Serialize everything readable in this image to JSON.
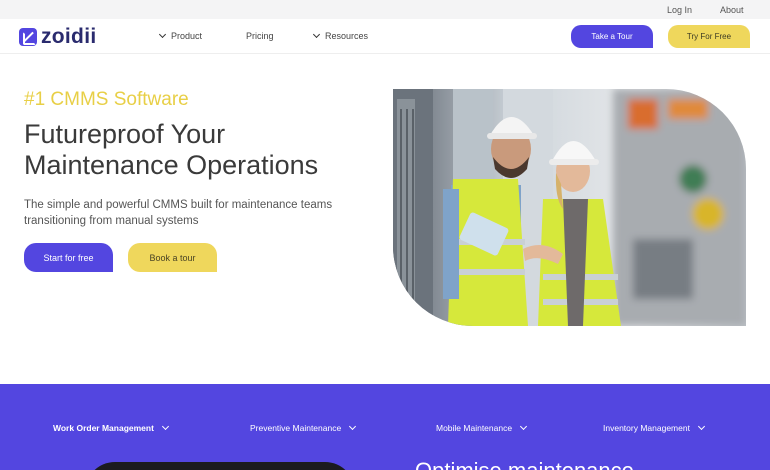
{
  "utility": {
    "login": "Log In",
    "about": "About"
  },
  "nav": {
    "logo_text": "zoidii",
    "items": [
      {
        "label": "Product",
        "has_dropdown": true
      },
      {
        "label": "Pricing",
        "has_dropdown": false
      },
      {
        "label": "Resources",
        "has_dropdown": true
      }
    ],
    "tour_button": "Take a Tour",
    "free_button": "Try For Free"
  },
  "hero": {
    "eyebrow": "#1 CMMS Software",
    "headline_line1": "Futureproof Your",
    "headline_line2": "Maintenance Operations",
    "subtext": "The simple and powerful CMMS built for maintenance teams transitioning from manual systems",
    "start_button": "Start for free",
    "book_button": "Book a tour"
  },
  "features": {
    "tabs": [
      {
        "label": "Work Order Management",
        "active": true
      },
      {
        "label": "Preventive Maintenance",
        "active": false
      },
      {
        "label": "Mobile Maintenance",
        "active": false
      },
      {
        "label": "Inventory Management",
        "active": false
      }
    ],
    "heading": "Optimise maintenance"
  },
  "colors": {
    "primary": "#5346e0",
    "accent_yellow": "#efd75c",
    "eyebrow_yellow": "#e8cf46",
    "heading_dark": "#3a3a3a"
  },
  "icons": {
    "logo": "zoidii-logo-icon",
    "dropdown": "chevron-down-icon"
  }
}
